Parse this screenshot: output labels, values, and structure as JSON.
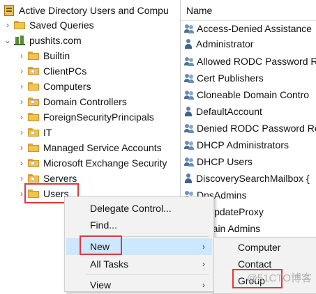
{
  "tree": {
    "root": "Active Directory Users and Compu",
    "saved_queries": "Saved Queries",
    "domain": "pushits.com",
    "ous": [
      "Builtin",
      "ClientPCs",
      "Computers",
      "Domain Controllers",
      "ForeignSecurityPrincipals",
      "IT",
      "Managed Service Accounts",
      "Microsoft Exchange Security",
      "Servers",
      "Users"
    ]
  },
  "list": {
    "header": "Name",
    "items": [
      {
        "name": "Access-Denied Assistance",
        "type": "group"
      },
      {
        "name": "Administrator",
        "type": "user"
      },
      {
        "name": "Allowed RODC Password R",
        "type": "group"
      },
      {
        "name": "Cert Publishers",
        "type": "group"
      },
      {
        "name": "Cloneable Domain Contro",
        "type": "group"
      },
      {
        "name": "DefaultAccount",
        "type": "user"
      },
      {
        "name": "Denied RODC Password Re",
        "type": "group"
      },
      {
        "name": "DHCP Administrators",
        "type": "group"
      },
      {
        "name": "DHCP Users",
        "type": "group"
      },
      {
        "name": "DiscoverySearchMailbox {",
        "type": "user"
      },
      {
        "name": "DnsAdmins",
        "type": "group"
      },
      {
        "name": "UpdateProxy",
        "type": "group"
      },
      {
        "name": "main Admins",
        "type": "group"
      }
    ]
  },
  "context_menu": {
    "delegate": "Delegate Control...",
    "find": "Find...",
    "new": "New",
    "all_tasks": "All Tasks",
    "view": "View"
  },
  "submenu": {
    "computer": "Computer",
    "contact": "Contact",
    "group": "Group"
  },
  "watermark": "@51CTO博客",
  "colors": {
    "highlight": "#e0393b",
    "selection": "#cce8ff"
  }
}
